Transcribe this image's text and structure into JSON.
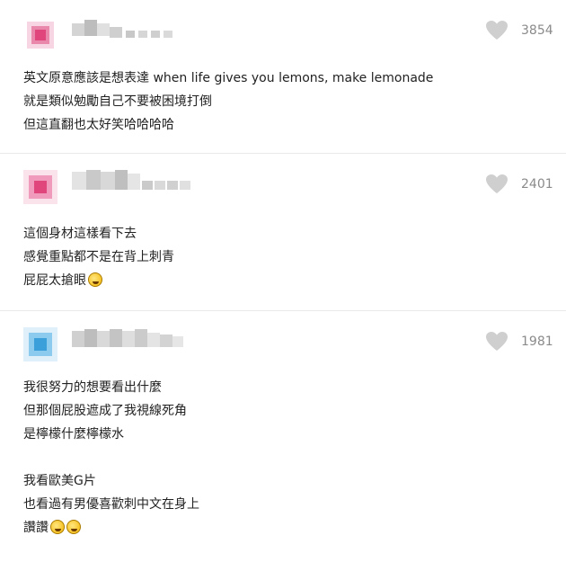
{
  "colors": {
    "heart": "#cfcfcf",
    "count": "#8a8a8a",
    "divider": "#e9e9e9",
    "avatar1": "#e0457b",
    "avatar2": "#e0457b",
    "avatar3": "#3b9fd9"
  },
  "comments": [
    {
      "like_count": "3854",
      "lines": [
        "英文原意應該是想表達 when life gives you lemons, make lemonade",
        "就是類似勉勵自己不要被困境打倒",
        "但這直翻也太好笑哈哈哈哈"
      ]
    },
    {
      "like_count": "2401",
      "lines": [
        "這個身材這樣看下去",
        "感覺重點都不是在背上刺青",
        "屁屁太搶眼"
      ],
      "emoji_after_line": 2,
      "emoji_icon": "laughing-emoji-icon"
    },
    {
      "like_count": "1981",
      "lines": [
        "我很努力的想要看出什麼",
        "但那個屁股遮成了我視線死角",
        "是檸檬什麼檸檬水",
        "",
        "我看歐美G片",
        "也看過有男優喜歡刺中文在身上",
        "讚讚"
      ],
      "emoji_icon": "grinning-emoji-icon"
    }
  ]
}
